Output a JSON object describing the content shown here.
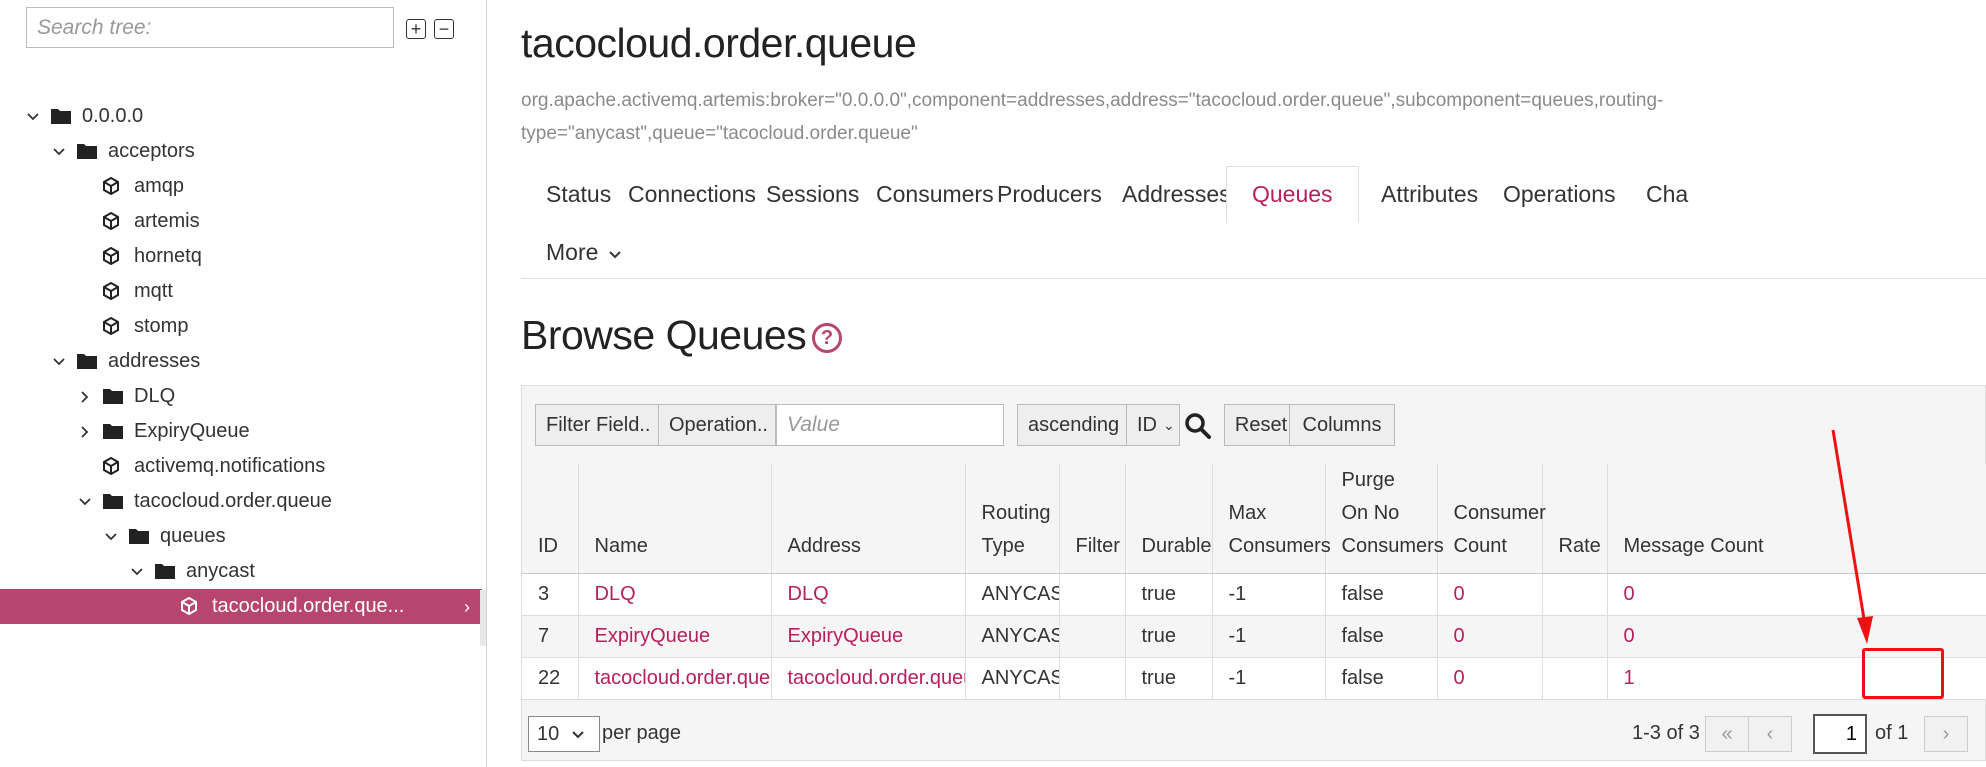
{
  "sidebar": {
    "search_placeholder": "Search tree:",
    "expand_all": "+",
    "collapse_all": "−",
    "tree": [
      {
        "label": "0.0.0.0",
        "level": 0,
        "toggle": "expanded",
        "icon": "folder-icon"
      },
      {
        "label": "acceptors",
        "level": 1,
        "toggle": "expanded",
        "icon": "folder-icon"
      },
      {
        "label": "amqp",
        "level": 2,
        "toggle": "none",
        "icon": "cube-icon"
      },
      {
        "label": "artemis",
        "level": 2,
        "toggle": "none",
        "icon": "cube-icon"
      },
      {
        "label": "hornetq",
        "level": 2,
        "toggle": "none",
        "icon": "cube-icon"
      },
      {
        "label": "mqtt",
        "level": 2,
        "toggle": "none",
        "icon": "cube-icon"
      },
      {
        "label": "stomp",
        "level": 2,
        "toggle": "none",
        "icon": "cube-icon"
      },
      {
        "label": "addresses",
        "level": 1,
        "toggle": "expanded",
        "icon": "folder-icon"
      },
      {
        "label": "DLQ",
        "level": 2,
        "toggle": "collapsed",
        "icon": "folder-icon"
      },
      {
        "label": "ExpiryQueue",
        "level": 2,
        "toggle": "collapsed",
        "icon": "folder-icon"
      },
      {
        "label": "activemq.notifications",
        "level": 2,
        "toggle": "none",
        "icon": "cube-icon"
      },
      {
        "label": "tacocloud.order.queue",
        "level": 2,
        "toggle": "expanded",
        "icon": "folder-icon"
      },
      {
        "label": "queues",
        "level": 3,
        "toggle": "expanded",
        "icon": "folder-icon"
      },
      {
        "label": "anycast",
        "level": 4,
        "toggle": "expanded",
        "icon": "folder-icon"
      },
      {
        "label": "tacocloud.order.que...",
        "level": 5,
        "toggle": "none",
        "icon": "cube-icon",
        "selected": true
      }
    ]
  },
  "header": {
    "title": "tacocloud.order.queue",
    "mbean": "org.apache.activemq.artemis:broker=\"0.0.0.0\",component=addresses,address=\"tacocloud.order.queue\",subcomponent=queues,routing-type=\"anycast\",queue=\"tacocloud.order.queue\""
  },
  "tabs": [
    {
      "label": "Status"
    },
    {
      "label": "Connections"
    },
    {
      "label": "Sessions"
    },
    {
      "label": "Consumers"
    },
    {
      "label": "Producers"
    },
    {
      "label": "Addresses"
    },
    {
      "label": "Queues",
      "active": true
    },
    {
      "label": "Attributes"
    },
    {
      "label": "Operations"
    },
    {
      "label": "Cha"
    }
  ],
  "more_tab": "More",
  "section": {
    "title": "Browse Queues",
    "help": "?"
  },
  "toolbar": {
    "filter_field": "Filter Field..",
    "operation": "Operation..",
    "value_placeholder": "Value",
    "sort_order": "ascending",
    "sort_field": "ID",
    "reset": "Reset",
    "columns": "Columns"
  },
  "table": {
    "headers": [
      "ID",
      "Name",
      "Address",
      "Routing Type",
      "Filter",
      "Durable",
      "Max Consumers",
      "Purge On No Consumers",
      "Consumer Count",
      "Rate",
      "Message Count"
    ],
    "rows": [
      {
        "id": "3",
        "name": "DLQ",
        "address": "DLQ",
        "routing": "ANYCAST",
        "filter": "",
        "durable": "true",
        "max": "-1",
        "purge": "false",
        "consumers": "0",
        "rate": "",
        "messages": "0"
      },
      {
        "id": "7",
        "name": "ExpiryQueue",
        "address": "ExpiryQueue",
        "routing": "ANYCAST",
        "filter": "",
        "durable": "true",
        "max": "-1",
        "purge": "false",
        "consumers": "0",
        "rate": "",
        "messages": "0"
      },
      {
        "id": "22",
        "name": "tacocloud.order.queue",
        "address": "tacocloud.order.queue",
        "routing": "ANYCAST",
        "filter": "",
        "durable": "true",
        "max": "-1",
        "purge": "false",
        "consumers": "0",
        "rate": "",
        "messages": "1"
      }
    ]
  },
  "pagination": {
    "per_page_value": "10",
    "per_page_label": "per page",
    "range": "1-3 of 3",
    "current_page": "1",
    "of_pages": "of 1"
  },
  "colors": {
    "accent": "#b7205f",
    "selected_bg": "#b7466f",
    "annotation": "#ee1111"
  }
}
